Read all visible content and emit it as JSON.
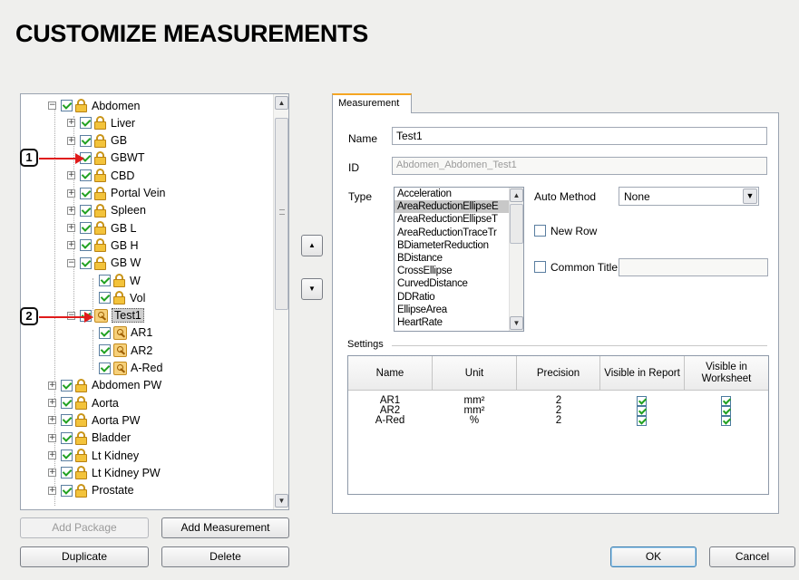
{
  "page_title": "CUSTOMIZE MEASUREMENTS",
  "tree": {
    "items": [
      {
        "label": "Abdomen",
        "expander": "−",
        "icon": "lock"
      },
      {
        "label": "Liver",
        "expander": "+",
        "icon": "lock"
      },
      {
        "label": "GB",
        "expander": "+",
        "icon": "lock"
      },
      {
        "label": "GBWT",
        "expander": "",
        "icon": "lock"
      },
      {
        "label": "CBD",
        "expander": "+",
        "icon": "lock"
      },
      {
        "label": "Portal Vein",
        "expander": "+",
        "icon": "lock"
      },
      {
        "label": "Spleen",
        "expander": "+",
        "icon": "lock"
      },
      {
        "label": "GB L",
        "expander": "+",
        "icon": "lock"
      },
      {
        "label": "GB H",
        "expander": "+",
        "icon": "lock"
      },
      {
        "label": "GB W",
        "expander": "−",
        "icon": "lock"
      },
      {
        "label": "W",
        "expander": "",
        "icon": "lock"
      },
      {
        "label": "Vol",
        "expander": "",
        "icon": "lock"
      },
      {
        "label": "Test1",
        "expander": "−",
        "icon": "key"
      },
      {
        "label": "AR1",
        "expander": "",
        "icon": "key"
      },
      {
        "label": "AR2",
        "expander": "",
        "icon": "key"
      },
      {
        "label": "A-Red",
        "expander": "",
        "icon": "key"
      },
      {
        "label": "Abdomen PW",
        "expander": "+",
        "icon": "lock"
      },
      {
        "label": "Aorta",
        "expander": "+",
        "icon": "lock"
      },
      {
        "label": "Aorta PW",
        "expander": "+",
        "icon": "lock"
      },
      {
        "label": "Bladder",
        "expander": "+",
        "icon": "lock"
      },
      {
        "label": "Lt Kidney",
        "expander": "+",
        "icon": "lock"
      },
      {
        "label": "Lt Kidney PW",
        "expander": "+",
        "icon": "lock"
      },
      {
        "label": "Prostate",
        "expander": "+",
        "icon": "lock"
      }
    ],
    "selected": "Test1"
  },
  "callouts": [
    "1",
    "2"
  ],
  "buttons": {
    "add_package": "Add Package",
    "add_measurement": "Add Measurement",
    "duplicate": "Duplicate",
    "delete": "Delete",
    "ok": "OK",
    "cancel": "Cancel",
    "move_up": "▲",
    "move_down": "▼"
  },
  "measurement_tab": {
    "tab_label": "Measurement",
    "name_label": "Name",
    "name_value": "Test1",
    "id_label": "ID",
    "id_value": "Abdomen_Abdomen_Test1",
    "type_label": "Type",
    "type_options": [
      "Acceleration",
      "AreaReductionEllipseE",
      "AreaReductionEllipseT",
      "AreaReductionTraceTr",
      "BDiameterReduction",
      "BDistance",
      "CrossEllipse",
      "CurvedDistance",
      "DDRatio",
      "EllipseArea",
      "HeartRate"
    ],
    "type_selected": "AreaReductionEllipseE",
    "auto_method_label": "Auto Method",
    "auto_method_value": "None",
    "new_row_label": "New Row",
    "common_title_label": "Common Title",
    "common_title_value": "",
    "settings_label": "Settings"
  },
  "settings_table": {
    "headers": [
      "Name",
      "Unit",
      "Precision",
      "Visible in Report",
      "Visible in Worksheet"
    ],
    "rows": [
      {
        "name": "AR1",
        "unit": "mm²",
        "precision": "2",
        "visible_report": true,
        "visible_worksheet": true
      },
      {
        "name": "AR2",
        "unit": "mm²",
        "precision": "2",
        "visible_report": true,
        "visible_worksheet": true
      },
      {
        "name": "A-Red",
        "unit": "%",
        "precision": "2",
        "visible_report": true,
        "visible_worksheet": true
      }
    ]
  },
  "colors": {
    "callout_arrow": "#e01b1b",
    "tab_accent": "#f5a623",
    "check": "#21a121"
  }
}
